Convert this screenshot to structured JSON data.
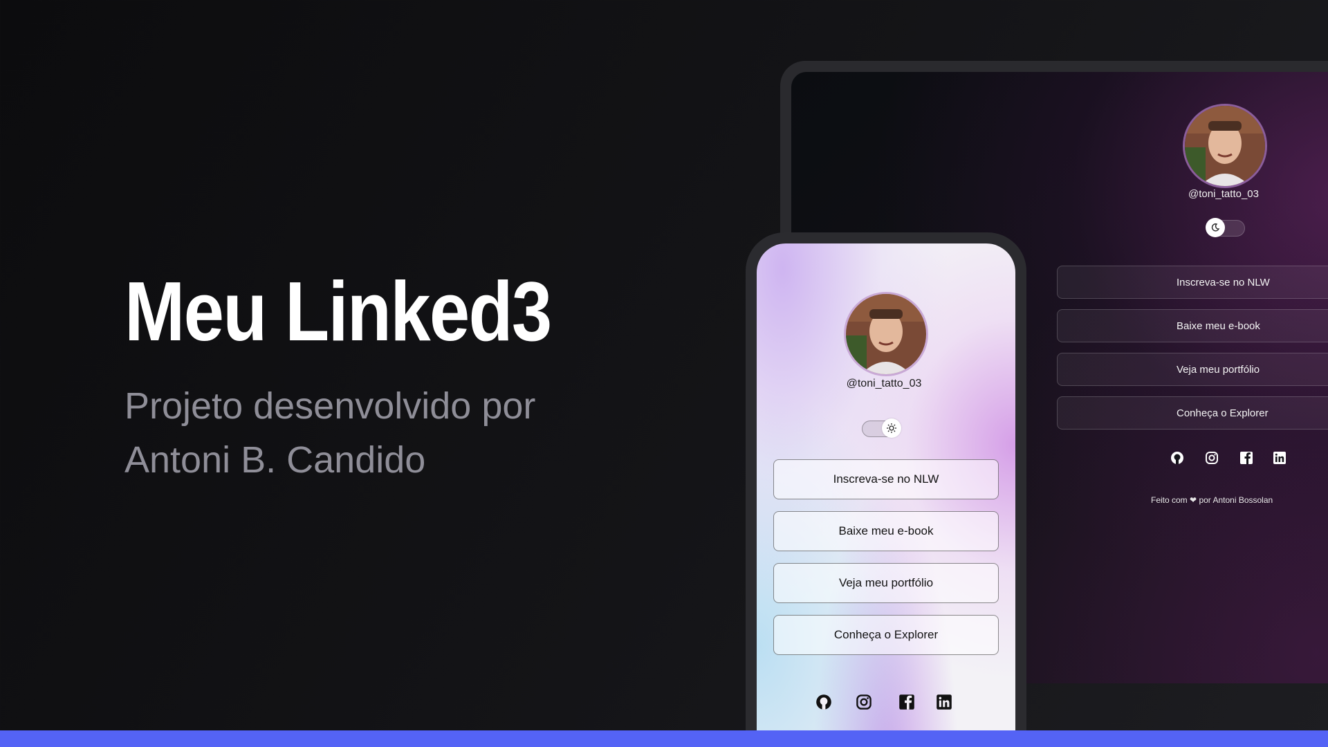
{
  "hero": {
    "title": "Meu Linked3",
    "subtitle": "Projeto desenvolvido por Antoni B. Candido"
  },
  "profile": {
    "handle": "@toni_tatto_03"
  },
  "links": [
    {
      "label": "Inscreva-se no NLW"
    },
    {
      "label": "Baixe meu e-book"
    },
    {
      "label": "Veja meu portfólio"
    },
    {
      "label": "Conheça o Explorer"
    }
  ],
  "social": [
    "github-icon",
    "instagram-icon",
    "facebook-icon",
    "linkedin-icon"
  ],
  "footer": {
    "prefix": "Feito com",
    "suffix": "por Antoni Bossolan"
  },
  "theme_toggle": {
    "desktop_mode": "dark",
    "mobile_mode": "light"
  },
  "colors": {
    "accent_bar": "#5463f5",
    "title": "#ffffff",
    "subtitle": "#8f8e98"
  }
}
